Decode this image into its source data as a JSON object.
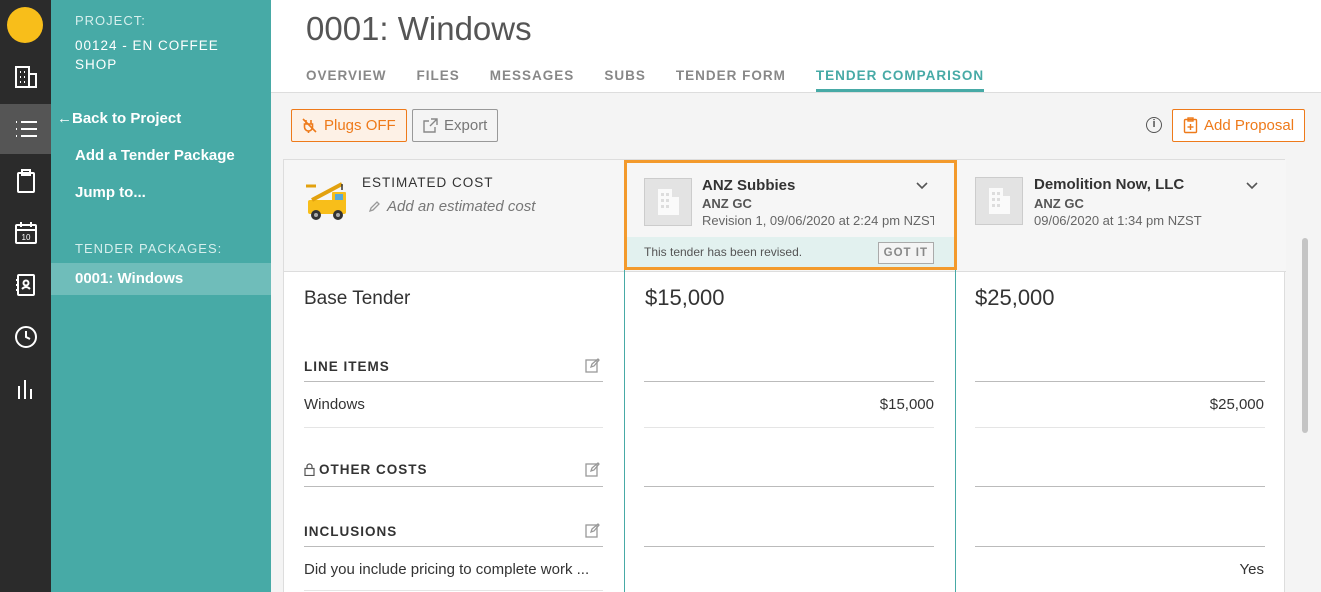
{
  "rail": {
    "items": [
      {
        "icon": "building-icon"
      },
      {
        "icon": "list-icon"
      },
      {
        "icon": "clipboard-icon"
      },
      {
        "icon": "calendar-icon",
        "day": "10"
      },
      {
        "icon": "contacts-book-icon"
      },
      {
        "icon": "clock-icon"
      },
      {
        "icon": "bar-chart-icon"
      }
    ]
  },
  "sidebar": {
    "project_caption": "PROJECT:",
    "project_name": "00124 - EN COFFEE SHOP",
    "back_arrow": "←",
    "back_label": "Back to Project",
    "add_package": "Add a Tender Package",
    "jump_to": "Jump to...",
    "packages_caption": "TENDER PACKAGES:",
    "active_package": "0001: Windows"
  },
  "header": {
    "title": "0001: Windows",
    "tabs": [
      {
        "label": "OVERVIEW"
      },
      {
        "label": "FILES"
      },
      {
        "label": "MESSAGES"
      },
      {
        "label": "SUBS"
      },
      {
        "label": "TENDER FORM"
      },
      {
        "label": "TENDER COMPARISON",
        "active": true
      }
    ]
  },
  "toolbar": {
    "plugs_label": "Plugs OFF",
    "export_label": "Export",
    "info": "i",
    "add_proposal_label": "Add Proposal"
  },
  "estimate": {
    "caption": "ESTIMATED COST",
    "placeholder": "Add an estimated cost"
  },
  "bidders": [
    {
      "name": "ANZ Subbies",
      "gc": "ANZ GC",
      "revision": "Revision 1, 09/06/2020 at 2:24 pm NZST",
      "notice": "This tender has been revised.",
      "notice_button": "GOT IT",
      "base_tender": "$15,000",
      "line_items": [
        "$15,000"
      ],
      "inclusions": [
        ""
      ]
    },
    {
      "name": "Demolition Now, LLC",
      "gc": "ANZ GC",
      "revision": "09/06/2020 at 1:34 pm NZST",
      "base_tender": "$25,000",
      "line_items": [
        "$25,000"
      ],
      "inclusions": [
        "Yes"
      ]
    }
  ],
  "rows": {
    "base_tender": "Base Tender",
    "line_items_caption": "LINE ITEMS",
    "line_items": [
      "Windows"
    ],
    "other_costs_caption": "OTHER COSTS",
    "inclusions_caption": "INCLUSIONS",
    "inclusions": [
      "Did you include pricing to complete work ..."
    ]
  },
  "colors": {
    "teal": "#47aaa6",
    "orange": "#ee7a1a",
    "rail": "#2b2b2b",
    "logo": "#f8be1a"
  }
}
